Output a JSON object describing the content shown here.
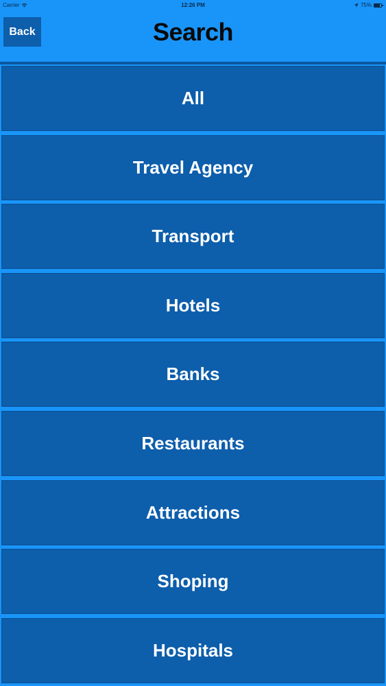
{
  "status_bar": {
    "carrier": "Carrier",
    "time": "12:26 PM",
    "battery": "75%",
    "battery_level": 0.75,
    "icons": [
      "wifi-icon",
      "location-arrow-icon",
      "battery-icon"
    ]
  },
  "nav": {
    "back_label": "Back",
    "title": "Search"
  },
  "categories": [
    {
      "label": "All"
    },
    {
      "label": "Travel Agency"
    },
    {
      "label": "Transport"
    },
    {
      "label": "Hotels"
    },
    {
      "label": "Banks"
    },
    {
      "label": "Restaurants"
    },
    {
      "label": "Attractions"
    },
    {
      "label": "Shoping"
    },
    {
      "label": "Hospitals"
    }
  ],
  "colors": {
    "background": "#1995f9",
    "button": "#0d5eab",
    "text": "#ffffff",
    "title": "#0a0a0a"
  }
}
